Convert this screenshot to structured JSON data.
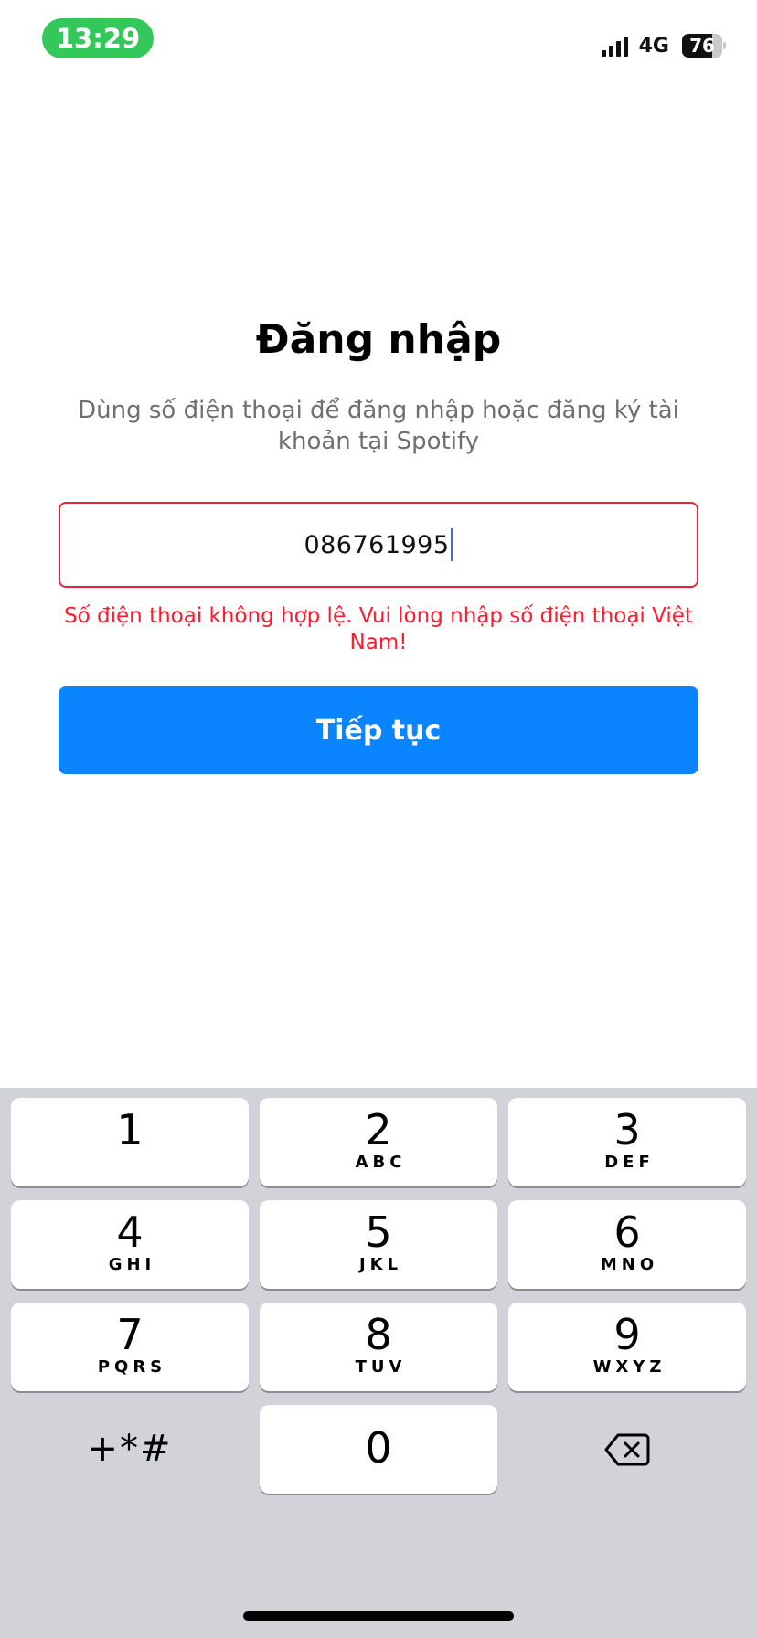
{
  "status_bar": {
    "time": "13:29",
    "network": "4G",
    "battery_level": "76",
    "battery_fraction": 0.76,
    "signal_icon": "cellular-signal-icon",
    "battery_icon": "battery-icon"
  },
  "login": {
    "title": "Đăng nhập",
    "subtitle": "Dùng số điện thoại để đăng nhập hoặc đăng ký tài khoản tại Spotify",
    "phone_value": "086761995",
    "error_message": "Số điện thoại không hợp lệ. Vui lòng nhập số điện thoại Việt Nam!",
    "continue_label": "Tiếp tục"
  },
  "keypad": {
    "keys": [
      {
        "digit": "1",
        "letters": ""
      },
      {
        "digit": "2",
        "letters": "ABC"
      },
      {
        "digit": "3",
        "letters": "DEF"
      },
      {
        "digit": "4",
        "letters": "GHI"
      },
      {
        "digit": "5",
        "letters": "JKL"
      },
      {
        "digit": "6",
        "letters": "MNO"
      },
      {
        "digit": "7",
        "letters": "PQRS"
      },
      {
        "digit": "8",
        "letters": "TUV"
      },
      {
        "digit": "9",
        "letters": "WXYZ"
      }
    ],
    "symbols": "+*#",
    "zero": "0",
    "delete_icon": "backspace-icon"
  },
  "colors": {
    "time_pill": "#34c759",
    "error": "#ff1a2d",
    "field_border_error": "#e5263a",
    "button": "#0a84ff",
    "keypad_bg": "#d1d3d9",
    "caret": "#2f6bff"
  }
}
